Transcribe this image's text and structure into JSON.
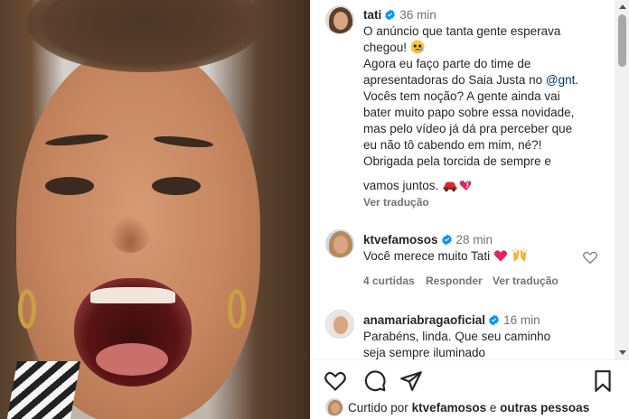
{
  "post": {
    "author": "tati",
    "time": "36 min",
    "caption_lines": [
      "O anúncio que tanta gente esperava",
      "chegou! ",
      "Agora eu faço parte do time de",
      "apresentadoras do Saia Justa no ",
      "Vocês tem noção? A gente ainda vai",
      "bater muito papo sobre essa novidade,",
      "mas pelo vídeo já dá pra perceber que",
      "eu não tô cabendo em mim, né?!",
      "Obrigada pela torcida de sempre e",
      "vamos juntos. "
    ],
    "mention": "@gnt.",
    "see_translation": "Ver tradução"
  },
  "comments": [
    {
      "author": "ktvefamosos",
      "time": "28 min",
      "text": "Você merece muito Tati ",
      "likes": "4 curtidas",
      "reply": "Responder",
      "see_translation": "Ver tradução"
    },
    {
      "author": "anamariabragaoficial",
      "time": "16 min",
      "text_lines": [
        "Parabéns, linda. Que seu caminho",
        "seja sempre iluminado"
      ]
    }
  ],
  "footer": {
    "liked_by_prefix": "Curtido por",
    "liked_by_user": "ktvefamosos",
    "liked_by_conjunction": "e",
    "liked_by_others": "outras pessoas"
  },
  "icons": {
    "like": "heart-outline-icon",
    "comment": "speech-bubble-icon",
    "share": "paper-plane-icon",
    "save": "bookmark-icon",
    "verified": "verified-badge-icon",
    "emojis": [
      "pleading-face",
      "car-heart-emojis",
      "red-heart",
      "raising-hands"
    ]
  },
  "colors": {
    "verified": "#0095f6",
    "heart": "#e0245e",
    "text": "#262626",
    "muted": "#737373",
    "link": "#00376b"
  }
}
